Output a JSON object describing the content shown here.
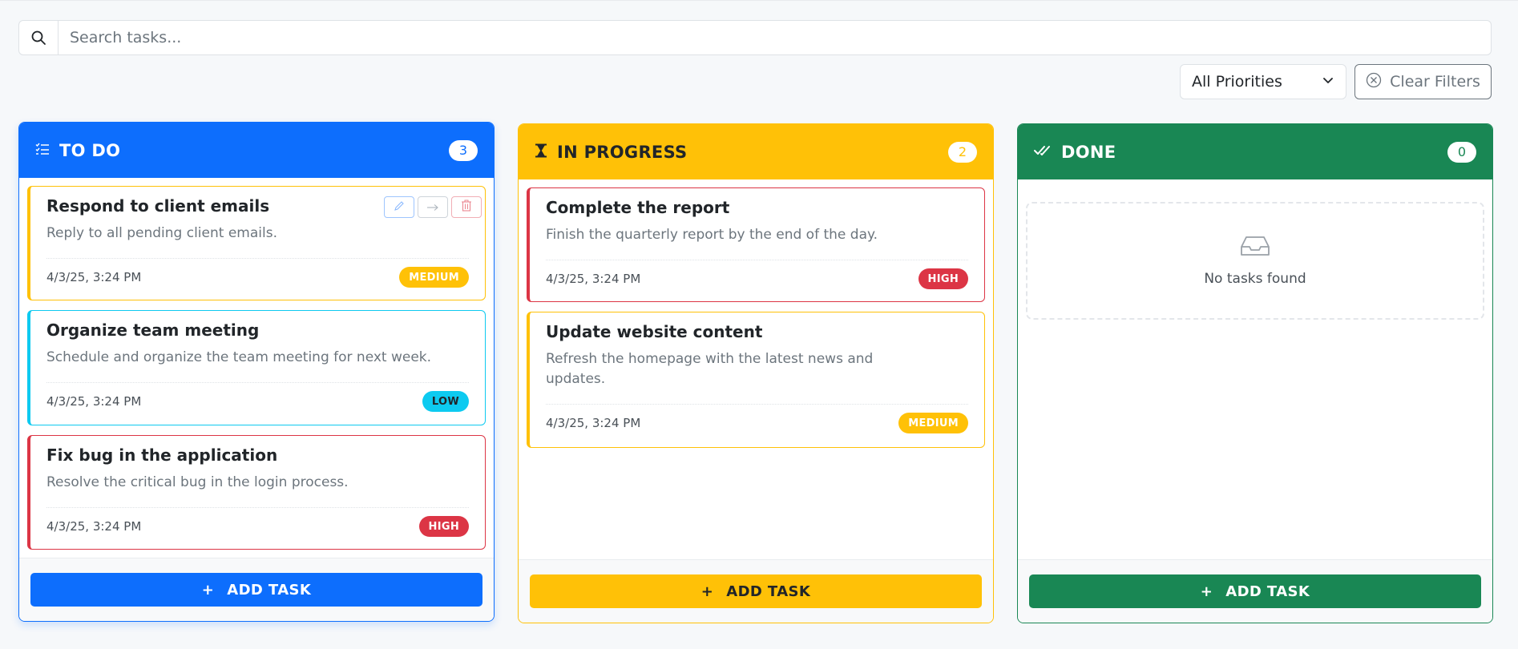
{
  "search": {
    "placeholder": "Search tasks..."
  },
  "filters": {
    "priority_value": "All Priorities",
    "clear_label": "Clear Filters"
  },
  "columns": [
    {
      "title": "TO DO",
      "count": "3",
      "add_label": "ADD TASK",
      "tasks": [
        {
          "title": "Respond to client emails",
          "description": "Reply to all pending client emails.",
          "date": "4/3/25, 3:24 PM",
          "priority": "MEDIUM"
        },
        {
          "title": "Organize team meeting",
          "description": "Schedule and organize the team meeting for next week.",
          "date": "4/3/25, 3:24 PM",
          "priority": "LOW"
        },
        {
          "title": "Fix bug in the application",
          "description": "Resolve the critical bug in the login process.",
          "date": "4/3/25, 3:24 PM",
          "priority": "HIGH"
        }
      ]
    },
    {
      "title": "IN PROGRESS",
      "count": "2",
      "add_label": "ADD TASK",
      "tasks": [
        {
          "title": "Complete the report",
          "description": "Finish the quarterly report by the end of the day.",
          "date": "4/3/25, 3:24 PM",
          "priority": "HIGH"
        },
        {
          "title": "Update website content",
          "description": "Refresh the homepage with the latest news and updates.",
          "date": "4/3/25, 3:24 PM",
          "priority": "MEDIUM"
        }
      ]
    },
    {
      "title": "DONE",
      "count": "0",
      "add_label": "ADD TASK",
      "empty_text": "No tasks found",
      "tasks": []
    }
  ],
  "add_icon": "+",
  "colors": {
    "todo": "#0d6efd",
    "in_progress": "#ffc107",
    "done": "#198754",
    "high": "#dc3545",
    "medium": "#ffc107",
    "low": "#0dcaf0"
  },
  "icons": {
    "search": "search-icon",
    "todo": "list-check-icon",
    "in_progress": "hourglass-icon",
    "done": "double-check-icon",
    "empty": "inbox-icon",
    "edit": "pencil-icon",
    "move": "arrow-right-icon",
    "delete": "trash-icon",
    "clear": "circle-x-icon",
    "dropdown": "chevron-down-icon"
  }
}
